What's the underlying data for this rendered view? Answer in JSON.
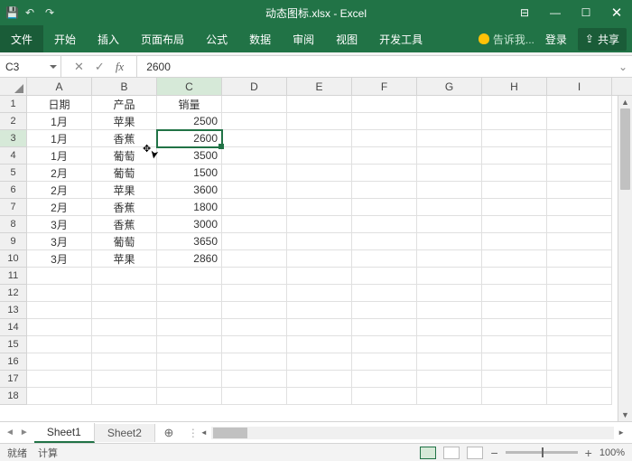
{
  "titlebar": {
    "filename": "动态图标.xlsx - Excel"
  },
  "ribbon": {
    "tabs": {
      "file": "文件",
      "home": "开始",
      "insert": "插入",
      "pagelayout": "页面布局",
      "formulas": "公式",
      "data": "数据",
      "review": "审阅",
      "view": "视图",
      "dev": "开发工具"
    },
    "tell": "告诉我...",
    "login": "登录",
    "share": "共享"
  },
  "namebox": {
    "ref": "C3"
  },
  "formula": {
    "value": "2600"
  },
  "columns": [
    "A",
    "B",
    "C",
    "D",
    "E",
    "F",
    "G",
    "H",
    "I"
  ],
  "headers": {
    "A": "日期",
    "B": "产品",
    "C": "销量"
  },
  "chart_data": {
    "type": "table",
    "columns": [
      "日期",
      "产品",
      "销量"
    ],
    "rows": [
      [
        "1月",
        "苹果",
        2500
      ],
      [
        "1月",
        "香蕉",
        2600
      ],
      [
        "1月",
        "葡萄",
        3500
      ],
      [
        "2月",
        "葡萄",
        1500
      ],
      [
        "2月",
        "苹果",
        3600
      ],
      [
        "2月",
        "香蕉",
        1800
      ],
      [
        "3月",
        "香蕉",
        3000
      ],
      [
        "3月",
        "葡萄",
        3650
      ],
      [
        "3月",
        "苹果",
        2860
      ]
    ]
  },
  "sheets": {
    "s1": "Sheet1",
    "s2": "Sheet2"
  },
  "status": {
    "ready": "就绪",
    "calc": "计算",
    "zoom": "100%"
  },
  "selected": {
    "row": 3,
    "col": "C"
  }
}
